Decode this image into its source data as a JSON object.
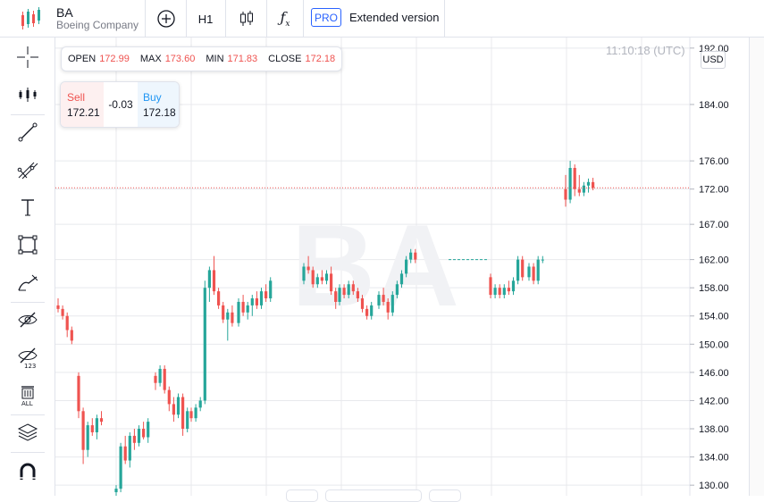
{
  "header": {
    "symbol": "BA",
    "company": "Boeing Company",
    "timeframe": "H1",
    "pro_badge": "PRO",
    "extended_label": "Extended version"
  },
  "ohlc": {
    "open_label": "OPEN",
    "open": "172.99",
    "max_label": "MAX",
    "max": "173.60",
    "min_label": "MIN",
    "min": "171.83",
    "close_label": "CLOSE",
    "close": "172.18"
  },
  "trade": {
    "sell_label": "Sell",
    "sell_price": "172.21",
    "spread": "-0.03",
    "buy_label": "Buy",
    "buy_price": "172.18"
  },
  "clock": "11:10:18 (UTC)",
  "currency": "USD",
  "watermark": "BA",
  "colors": {
    "up": "#26a69a",
    "down": "#ef5350",
    "grid": "#e8e9ed",
    "axis_text": "#131722"
  },
  "tools": [
    "crosshair-icon",
    "candles-icon",
    "trendline-icon",
    "fib-icon",
    "text-icon",
    "rectangle-icon",
    "brush-icon",
    "hide-drawings-icon",
    "hide-indicators-icon",
    "delete-all-icon",
    "layers-icon",
    "magnet-icon"
  ],
  "chart_data": {
    "type": "candlestick",
    "ylim": [
      128.5,
      193.5
    ],
    "y_ticks": [
      "192.00",
      "184.00",
      "176.00",
      "172.00",
      "167.00",
      "162.00",
      "158.00",
      "154.00",
      "150.00",
      "146.00",
      "142.00",
      "138.00",
      "134.00",
      "130.00"
    ],
    "last_price": 172.18,
    "grid": true,
    "candles": [
      [
        155.5,
        156.5,
        154.5,
        155.0
      ],
      [
        155.0,
        155.5,
        153.5,
        154.0
      ],
      [
        154.0,
        154.5,
        151.0,
        152.0
      ],
      [
        152.0,
        152.5,
        150.0,
        150.5
      ],
      [
        145.5,
        146.0,
        139.5,
        140.5
      ],
      [
        140.5,
        141.0,
        133.0,
        135.0
      ],
      [
        135.0,
        139.0,
        134.0,
        138.5
      ],
      [
        138.5,
        139.5,
        137.0,
        137.5
      ],
      [
        137.5,
        140.0,
        136.5,
        139.5
      ],
      [
        139.5,
        140.5,
        138.5,
        139.0
      ],
      [
        129.0,
        130.0,
        126.5,
        129.5
      ],
      [
        129.5,
        136.0,
        129.0,
        135.5
      ],
      [
        135.5,
        137.0,
        133.0,
        133.5
      ],
      [
        133.5,
        137.5,
        132.5,
        137.0
      ],
      [
        137.0,
        138.0,
        135.0,
        136.0
      ],
      [
        136.0,
        138.5,
        135.5,
        138.0
      ],
      [
        138.0,
        139.0,
        136.5,
        136.8
      ],
      [
        136.8,
        139.5,
        136.0,
        139.0
      ],
      [
        145.5,
        146.0,
        143.5,
        144.5
      ],
      [
        144.5,
        147.0,
        144.0,
        146.5
      ],
      [
        146.5,
        147.0,
        143.0,
        143.5
      ],
      [
        143.5,
        144.0,
        140.5,
        141.5
      ],
      [
        141.5,
        142.5,
        139.0,
        140.0
      ],
      [
        140.0,
        143.0,
        139.5,
        142.5
      ],
      [
        142.5,
        143.0,
        137.0,
        138.0
      ],
      [
        138.0,
        141.0,
        137.5,
        140.5
      ],
      [
        140.5,
        141.0,
        139.0,
        139.5
      ],
      [
        139.5,
        141.5,
        139.0,
        141.0
      ],
      [
        141.0,
        142.5,
        140.5,
        142.0
      ],
      [
        142.0,
        159.0,
        141.5,
        158.0
      ],
      [
        158.0,
        161.0,
        156.0,
        160.5
      ],
      [
        160.5,
        162.5,
        157.0,
        157.5
      ],
      [
        157.5,
        158.0,
        155.0,
        155.5
      ],
      [
        155.5,
        156.0,
        153.0,
        153.5
      ],
      [
        153.5,
        155.0,
        150.5,
        154.5
      ],
      [
        154.5,
        155.5,
        152.5,
        153.0
      ],
      [
        153.0,
        156.5,
        152.5,
        156.0
      ],
      [
        156.0,
        157.0,
        154.0,
        154.5
      ],
      [
        154.5,
        156.0,
        153.5,
        155.5
      ],
      [
        155.5,
        157.0,
        154.0,
        156.5
      ],
      [
        156.5,
        157.5,
        155.0,
        155.5
      ],
      [
        155.5,
        158.0,
        155.0,
        157.5
      ],
      [
        157.5,
        158.5,
        156.0,
        156.5
      ],
      [
        156.5,
        159.5,
        156.0,
        159.0
      ],
      [
        159.0,
        161.5,
        158.5,
        161.0
      ],
      [
        161.0,
        162.5,
        160.0,
        160.5
      ],
      [
        160.5,
        161.0,
        158.0,
        158.5
      ],
      [
        158.5,
        160.0,
        158.0,
        159.5
      ],
      [
        159.5,
        160.5,
        158.5,
        159.0
      ],
      [
        159.0,
        160.5,
        158.5,
        160.0
      ],
      [
        160.0,
        161.0,
        157.0,
        157.5
      ],
      [
        157.5,
        158.0,
        155.0,
        156.0
      ],
      [
        156.0,
        158.5,
        155.5,
        158.0
      ],
      [
        158.0,
        158.5,
        156.5,
        157.0
      ],
      [
        157.0,
        159.0,
        156.5,
        158.5
      ],
      [
        158.5,
        159.0,
        157.0,
        157.5
      ],
      [
        157.5,
        158.0,
        156.0,
        156.5
      ],
      [
        156.5,
        157.0,
        154.5,
        155.0
      ],
      [
        155.0,
        155.5,
        153.5,
        154.0
      ],
      [
        154.0,
        156.0,
        153.5,
        155.5
      ],
      [
        155.5,
        157.5,
        155.0,
        157.0
      ],
      [
        157.0,
        158.0,
        155.5,
        156.0
      ],
      [
        156.0,
        156.5,
        153.5,
        154.5
      ],
      [
        154.5,
        157.5,
        154.0,
        157.0
      ],
      [
        157.0,
        159.0,
        156.5,
        158.5
      ],
      [
        158.5,
        160.5,
        158.0,
        160.0
      ],
      [
        160.0,
        162.5,
        159.5,
        162.0
      ],
      [
        162.0,
        163.5,
        161.5,
        163.0
      ],
      [
        163.0,
        163.5,
        161.5,
        162.0
      ],
      [
        159.5,
        160.0,
        156.5,
        157.0
      ],
      [
        157.0,
        158.5,
        156.5,
        158.0
      ],
      [
        158.0,
        158.5,
        156.5,
        157.0
      ],
      [
        157.0,
        158.5,
        156.5,
        158.0
      ],
      [
        158.0,
        159.0,
        157.0,
        157.5
      ],
      [
        157.5,
        159.5,
        157.0,
        159.0
      ],
      [
        159.0,
        162.5,
        158.5,
        162.0
      ],
      [
        162.0,
        162.5,
        159.0,
        159.5
      ],
      [
        159.5,
        161.5,
        159.0,
        161.0
      ],
      [
        161.0,
        161.5,
        158.5,
        159.0
      ],
      [
        159.0,
        162.5,
        158.5,
        162.0
      ],
      [
        162.0,
        162.5,
        161.5,
        162.0
      ],
      [
        172.0,
        174.0,
        169.5,
        170.5
      ],
      [
        170.5,
        176.0,
        170.0,
        175.0
      ],
      [
        175.0,
        175.5,
        171.0,
        172.0
      ],
      [
        172.0,
        174.0,
        171.0,
        171.5
      ],
      [
        171.5,
        173.0,
        171.0,
        172.5
      ],
      [
        172.5,
        173.5,
        171.5,
        173.0
      ],
      [
        172.99,
        173.6,
        171.83,
        172.18
      ]
    ]
  }
}
